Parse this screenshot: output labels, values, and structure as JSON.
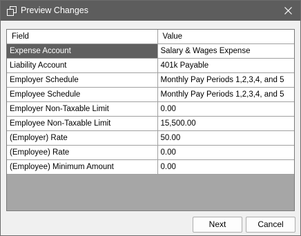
{
  "window": {
    "title": "Preview Changes"
  },
  "icons": {
    "title": "preview-windows-icon",
    "close": "close-icon"
  },
  "grid": {
    "columns": [
      "Field",
      "Value"
    ],
    "rows": [
      {
        "field": "Expense Account",
        "value": "Salary & Wages Expense",
        "selected": true
      },
      {
        "field": "Liability Account",
        "value": "401k Payable"
      },
      {
        "field": "Employer Schedule",
        "value": "Monthly Pay Periods 1,2,3,4, and 5"
      },
      {
        "field": "Employee Schedule",
        "value": "Monthly Pay Periods 1,2,3,4, and 5"
      },
      {
        "field": "Employer Non-Taxable Limit",
        "value": "0.00"
      },
      {
        "field": "Employee Non-Taxable Limit",
        "value": "15,500.00"
      },
      {
        "field": "(Employer) Rate",
        "value": "50.00"
      },
      {
        "field": "(Employee) Rate",
        "value": "0.00"
      },
      {
        "field": "(Employee) Minimum Amount",
        "value": "0.00"
      }
    ]
  },
  "buttons": {
    "next": "Next",
    "cancel": "Cancel"
  },
  "colors": {
    "titlebar": "#5d5d5d",
    "selected_row": "#5f5f5f",
    "grid_background": "#a6a6a6"
  }
}
